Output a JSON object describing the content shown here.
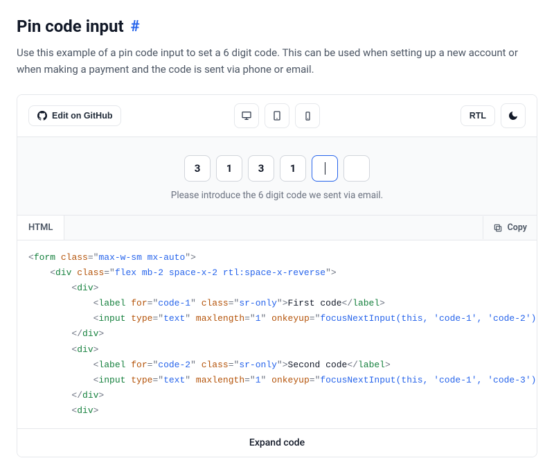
{
  "heading": "Pin code input",
  "hash": "#",
  "description": "Use this example of a pin code input to set a 6 digit code. This can be used when setting up a new account or when making a payment and the code is sent via phone or email.",
  "toolbar": {
    "edit_github": "Edit on GitHub",
    "rtl": "RTL"
  },
  "preview": {
    "pins": [
      "3",
      "1",
      "3",
      "1",
      "",
      ""
    ],
    "focused_index": 4,
    "helper": "Please introduce the 6 digit code we sent via email."
  },
  "code": {
    "tab": "HTML",
    "copy": "Copy",
    "expand": "Expand code",
    "lines": {
      "l1": {
        "pre": "<",
        "tag": "form",
        "post": " ",
        "a1": "class",
        "eq": "=\"",
        "v1": "max-w-sm mx-auto",
        "end": "\">"
      },
      "l2": {
        "pre": "    <",
        "tag": "div",
        "post": " ",
        "a1": "class",
        "eq": "=\"",
        "v1": "flex mb-2 space-x-2 rtl:space-x-reverse",
        "end": "\">"
      },
      "l3": {
        "pre": "        <",
        "tag": "div",
        "end": ">"
      },
      "l4": {
        "pre": "            <",
        "tag": "label",
        "post": " ",
        "a1": "for",
        "eq": "=\"",
        "v1": "code-1",
        "mid": "\" ",
        "a2": "class",
        "eq2": "=\"",
        "v2": "sr-only",
        "end2": "\">",
        "txt": "First code",
        "close": "</",
        "ctag": "label",
        "cend": ">"
      },
      "l5": {
        "pre": "            <",
        "tag": "input",
        "post": " ",
        "a1": "type",
        "eq": "=\"",
        "v1": "text",
        "mid": "\" ",
        "a2": "maxlength",
        "eq2": "=\"",
        "v2": "1",
        "mid2": "\" ",
        "a3": "onkeyup",
        "eq3": "=\"",
        "v3": "focusNextInput(this, 'code-1', 'code-2')",
        "end3": "\" i"
      },
      "l6": {
        "pre": "        </",
        "tag": "div",
        "end": ">"
      },
      "l7": {
        "pre": "        <",
        "tag": "div",
        "end": ">"
      },
      "l8": {
        "pre": "            <",
        "tag": "label",
        "post": " ",
        "a1": "for",
        "eq": "=\"",
        "v1": "code-2",
        "mid": "\" ",
        "a2": "class",
        "eq2": "=\"",
        "v2": "sr-only",
        "end2": "\">",
        "txt": "Second code",
        "close": "</",
        "ctag": "label",
        "cend": ">"
      },
      "l9": {
        "pre": "            <",
        "tag": "input",
        "post": " ",
        "a1": "type",
        "eq": "=\"",
        "v1": "text",
        "mid": "\" ",
        "a2": "maxlength",
        "eq2": "=\"",
        "v2": "1",
        "mid2": "\" ",
        "a3": "onkeyup",
        "eq3": "=\"",
        "v3": "focusNextInput(this, 'code-1', 'code-3')",
        "end3": "\" i"
      },
      "l10": {
        "pre": "        </",
        "tag": "div",
        "end": ">"
      },
      "l11": {
        "pre": "        <",
        "tag": "div",
        "end": ">"
      }
    }
  }
}
